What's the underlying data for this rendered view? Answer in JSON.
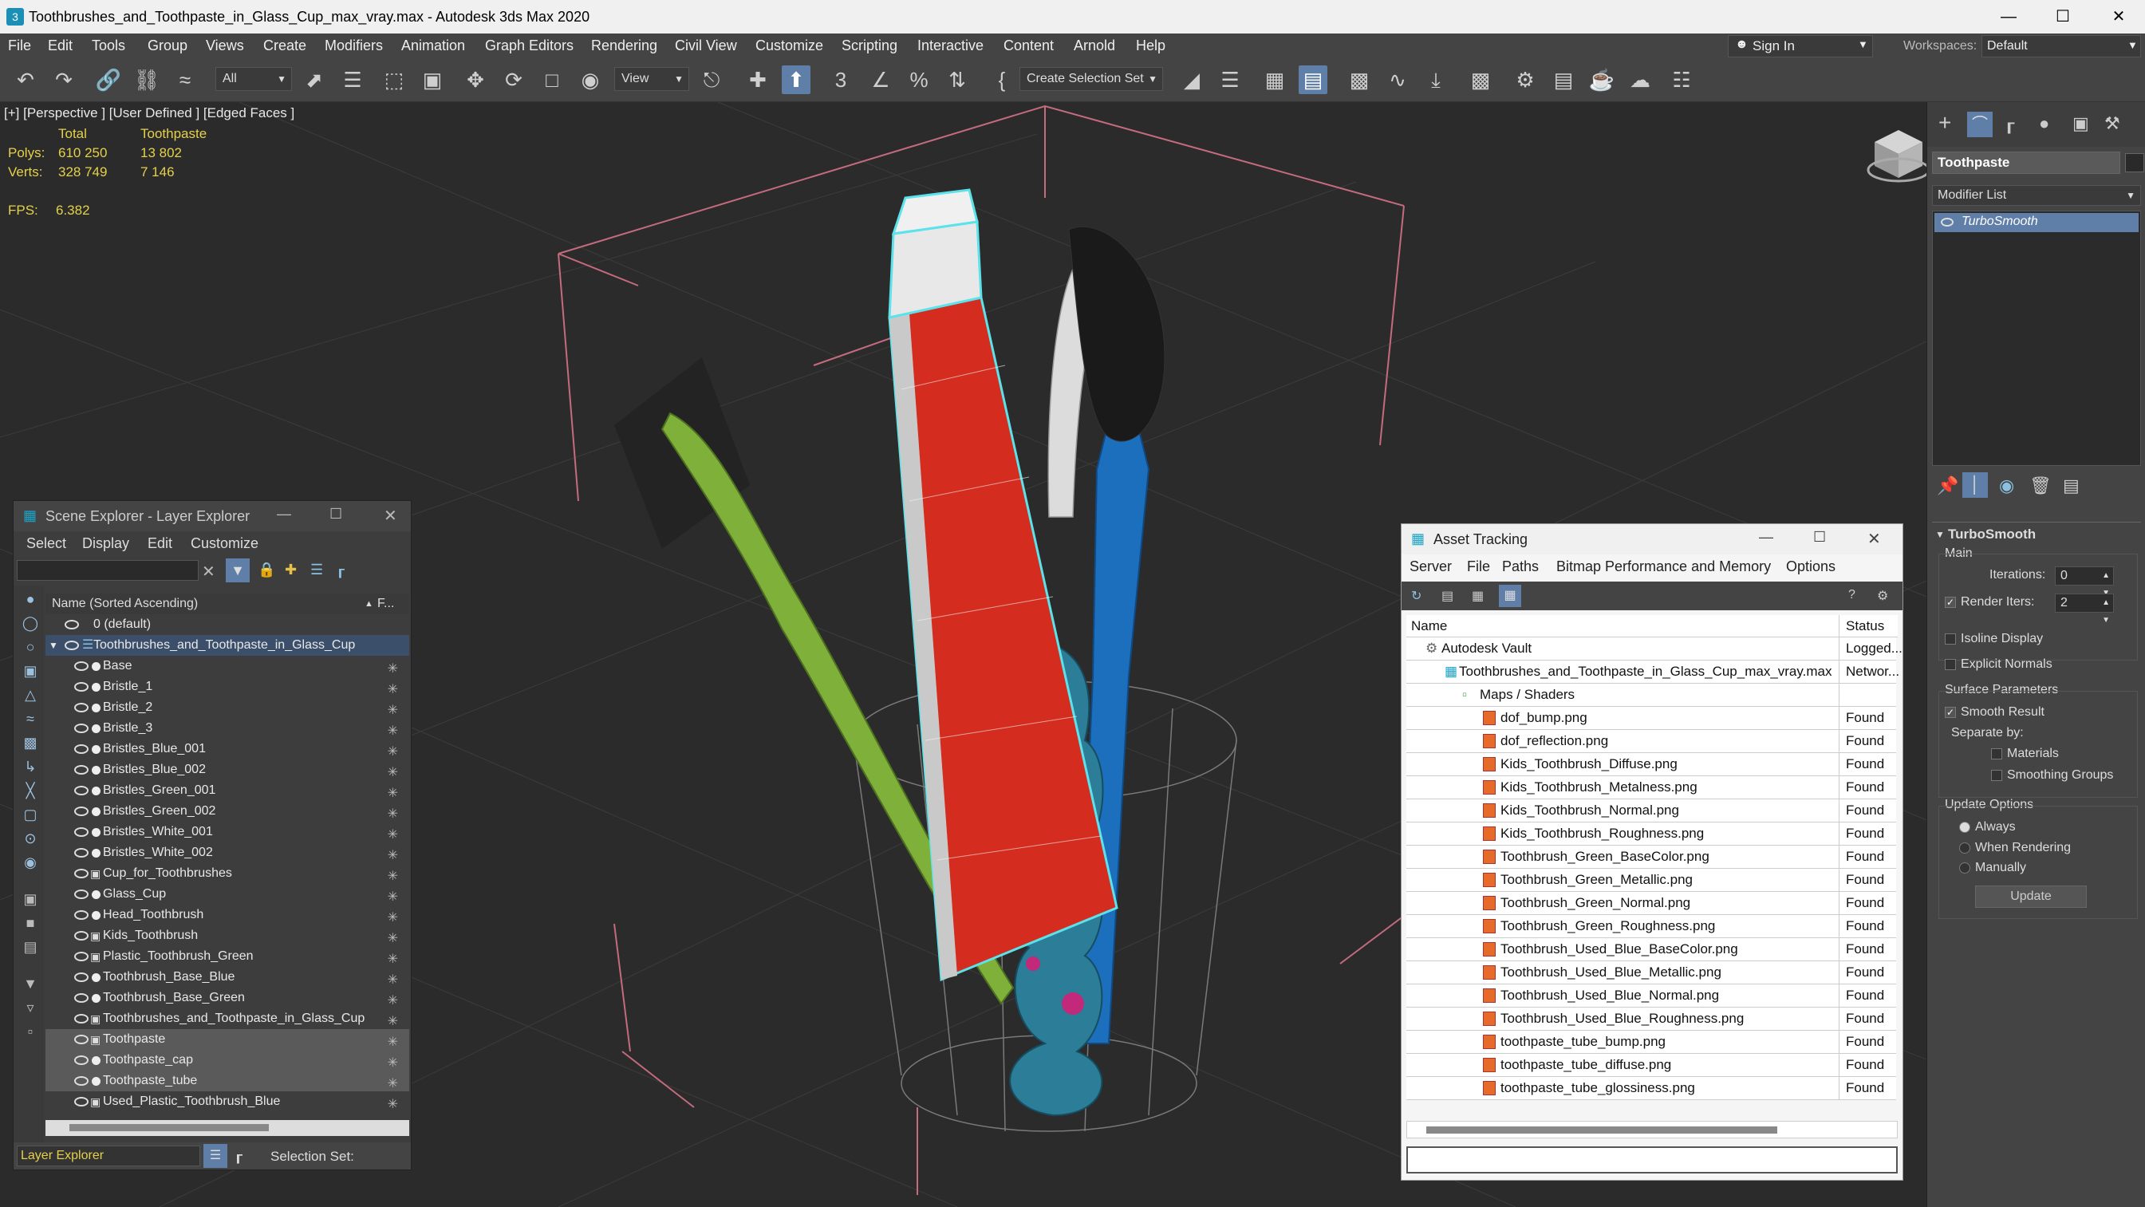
{
  "title": "Toothbrushes_and_Toothpaste_in_Glass_Cup_max_vray.max - Autodesk 3ds Max 2020",
  "menu": [
    "File",
    "Edit",
    "Tools",
    "Group",
    "Views",
    "Create",
    "Modifiers",
    "Animation",
    "Graph Editors",
    "Rendering",
    "Civil View",
    "Customize",
    "Scripting",
    "Interactive",
    "Content",
    "Arnold",
    "Help"
  ],
  "signin": "Sign In",
  "workspaces_label": "Workspaces:",
  "workspace_value": "Default",
  "toolbar": {
    "filter": "All",
    "refcoord": "View",
    "selection_set": "Create Selection Set"
  },
  "viewport": {
    "label": "[+] [Perspective ] [User Defined ] [Edged Faces ]",
    "stats_hdr_total": "Total",
    "stats_hdr_obj": "Toothpaste",
    "polys_label": "Polys:",
    "polys_total": "610 250",
    "polys_obj": "13 802",
    "verts_label": "Verts:",
    "verts_total": "328 749",
    "verts_obj": "7 146",
    "fps_label": "FPS:",
    "fps_value": "6.382"
  },
  "scene_explorer": {
    "title": "Scene Explorer - Layer Explorer",
    "menu": [
      "Select",
      "Display",
      "Edit",
      "Customize"
    ],
    "col_name": "Name (Sorted Ascending)",
    "col_f": "F...",
    "layer_default": "0 (default)",
    "layer_main": "Toothbrushes_and_Toothpaste_in_Glass_Cup",
    "items": [
      "Base",
      "Bristle_1",
      "Bristle_2",
      "Bristle_3",
      "Bristles_Blue_001",
      "Bristles_Blue_002",
      "Bristles_Green_001",
      "Bristles_Green_002",
      "Bristles_White_001",
      "Bristles_White_002",
      "Cup_for_Toothbrushes",
      "Glass_Cup",
      "Head_Toothbrush",
      "Kids_Toothbrush",
      "Plastic_Toothbrush_Green",
      "Toothbrush_Base_Blue",
      "Toothbrush_Base_Green",
      "Toothbrushes_and_Toothpaste_in_Glass_Cup",
      "Toothpaste",
      "Toothpaste_cap",
      "Toothpaste_tube",
      "Used_Plastic_Toothbrush_Blue"
    ],
    "footer_explorer": "Layer Explorer",
    "footer_selset": "Selection Set:"
  },
  "asset_tracking": {
    "title": "Asset Tracking",
    "menu": [
      "Server",
      "File",
      "Paths",
      "Bitmap Performance and Memory",
      "Options"
    ],
    "col_name": "Name",
    "col_status": "Status",
    "vault": "Autodesk Vault",
    "vault_status": "Logged...",
    "file": "Toothbrushes_and_Toothpaste_in_Glass_Cup_max_vray.max",
    "file_status": "Networ...",
    "maps": "Maps / Shaders",
    "assets": [
      {
        "name": "dof_bump.png",
        "status": "Found"
      },
      {
        "name": "dof_reflection.png",
        "status": "Found"
      },
      {
        "name": "Kids_Toothbrush_Diffuse.png",
        "status": "Found"
      },
      {
        "name": "Kids_Toothbrush_Metalness.png",
        "status": "Found"
      },
      {
        "name": "Kids_Toothbrush_Normal.png",
        "status": "Found"
      },
      {
        "name": "Kids_Toothbrush_Roughness.png",
        "status": "Found"
      },
      {
        "name": "Toothbrush_Green_BaseColor.png",
        "status": "Found"
      },
      {
        "name": "Toothbrush_Green_Metallic.png",
        "status": "Found"
      },
      {
        "name": "Toothbrush_Green_Normal.png",
        "status": "Found"
      },
      {
        "name": "Toothbrush_Green_Roughness.png",
        "status": "Found"
      },
      {
        "name": "Toothbrush_Used_Blue_BaseColor.png",
        "status": "Found"
      },
      {
        "name": "Toothbrush_Used_Blue_Metallic.png",
        "status": "Found"
      },
      {
        "name": "Toothbrush_Used_Blue_Normal.png",
        "status": "Found"
      },
      {
        "name": "Toothbrush_Used_Blue_Roughness.png",
        "status": "Found"
      },
      {
        "name": "toothpaste_tube_bump.png",
        "status": "Found"
      },
      {
        "name": "toothpaste_tube_diffuse.png",
        "status": "Found"
      },
      {
        "name": "toothpaste_tube_glossiness.png",
        "status": "Found"
      }
    ]
  },
  "command_panel": {
    "object_name": "Toothpaste",
    "modifier_list": "Modifier List",
    "stack_item": "TurboSmooth",
    "rollout": "TurboSmooth",
    "main": "Main",
    "iterations_label": "Iterations:",
    "iterations": "0",
    "render_iters_label": "Render Iters:",
    "render_iters": "2",
    "isoline": "Isoline Display",
    "explicit": "Explicit Normals",
    "surface": "Surface Parameters",
    "smooth_result": "Smooth Result",
    "separate_by": "Separate by:",
    "materials": "Materials",
    "smoothing_groups": "Smoothing Groups",
    "update_options": "Update Options",
    "always": "Always",
    "when_rendering": "When Rendering",
    "manually": "Manually",
    "update_btn": "Update"
  }
}
